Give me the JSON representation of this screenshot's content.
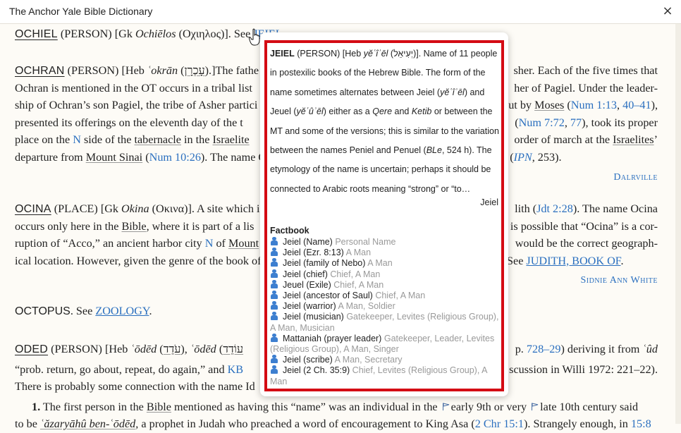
{
  "window": {
    "title": "The Anchor Yale Bible Dictionary",
    "close_icon": "×"
  },
  "ochiel": {
    "hw": "OCHIEL",
    "type": "(PERSON)",
    "gk_pre": "[Gk ",
    "gk_trans": "Ochiēlos",
    "gk_open": " (",
    "gk": "Οχιηλος",
    "gk_close": ")]. See ",
    "see": "JEIEL",
    "end": "."
  },
  "ochran": {
    "hw": "OCHRAN",
    "type": "(PERSON)",
    "heb_pre": "[Heb ",
    "heb_trans": "ʿokrān",
    "heb_open": " (",
    "heb": "עָכְרָן",
    "heb_close": ").]The fathe",
    "right1": "sher. Each of the five times that",
    "line2a": "Ochran is mentioned in the OT occurs in a tribal list",
    "line2b": "her of Pagiel. Under the leader-",
    "line3a": "ship of Ochran’s son Pagiel, the tribe of Asher partici",
    "line3b": "out by ",
    "moses": "Moses",
    "line3c": " (",
    "ref1": "Num 1:13",
    "comma": ", ",
    "ref2": "40–41",
    "line3d": "),",
    "line4a": "presented its offerings on the eleventh day of the t",
    "line4b": " (",
    "ref3": "Num 7:72",
    "ref4": "77",
    "line4c": "), took its proper",
    "line5a": "place on the ",
    "n": "N",
    "line5b": " side of the ",
    "tabernacle": "tabernacle",
    "line5c": " in the ",
    "israelite": "Israelite",
    "line5d": "order of march at the ",
    "israelites": "Israelites",
    "line5e": "’",
    "line6a": "departure from ",
    "sinai": "Mount Sinai",
    "line6b": " (",
    "ref5": "Num 10:26",
    "line6c": "). The name O",
    "line6d": "” (",
    "ipn": "IPN",
    "line6e": ", 253).",
    "author": "Dalrville"
  },
  "ocina": {
    "hw": "OCINA",
    "type": "(PLACE)",
    "gk_pre": "[Gk ",
    "gk_trans": "Okina",
    "gk_open": " (",
    "gk": "Οκινα",
    "gk_close": ")]. A site which is",
    "right1a": "lith (",
    "ref": "Jdt 2:28",
    "right1b": "). The name Ocina",
    "line2a": "occurs only here in the ",
    "bible": "Bible",
    "line2b": ", where it is part of a lis",
    "line2c": "is possible that “Ocina” is a cor-",
    "line3a": "ruption of “Acco,” an ancient harbor city ",
    "n": "N",
    "line3b": " of ",
    "mount": "Mount",
    "line3c": "would be the correct geograph-",
    "line4a": "ical location. However, given the genre of the book of",
    "line4b": "See ",
    "judith": "JUDITH, BOOK OF",
    "line4c": ".",
    "author": "Sidnie Ann White"
  },
  "octopus": {
    "hw": "OCTOPUS",
    "see": ". See ",
    "link": "ZOOLOGY",
    "end": "."
  },
  "oded": {
    "hw": "ODED",
    "type": "(PERSON)",
    "heb_pre": "[Heb ",
    "heb_trans": "ʿōdēd",
    "heb_open": " (",
    "heb": "עֹדֵד",
    "heb_mid": "), ",
    "heb_trans2": "ʿōdēd",
    "heb_open2": " (",
    "heb2": "עוֹדֵד",
    "right1a": "p. ",
    "ref1": "728–29",
    "right1b": ") deriving it from ",
    "root": "ʿûd",
    "line2a": "“prob. return, go about, repeat, do again,” and ",
    "kb": "KB",
    "line2b": "scussion in Willi 1972: 221–22).",
    "line3a": "There is probably some connection with the name Id",
    "line4num": "1.",
    "line4a": " The first person in the ",
    "bible": "Bible",
    "line4b": " mentioned as having this “name” was an individual in the ",
    "line4c": "early 9th or very ",
    "line4d": "late 10th century said",
    "line5a": "to be ",
    "line5it": "ʿăzaryāhû ben-ʿōdēd",
    "line5b": ", a prophet in Judah who preached a word of encouragement to King Asa (",
    "ref2": "2 Chr 15:1",
    "line5c": "). Strangely enough, in ",
    "ref3": "15:8"
  },
  "popup": {
    "hw": "JEIEL",
    "text_a": " (PERSON) [Heb ",
    "trans": "yĕʿîʾēl",
    "open": " (",
    "heb": "יְעִיאֵל",
    "text_b": ")]. Name of 11 people in postexilic books of the Hebrew Bible. The form of the name sometimes alternates between Jeiel (",
    "trans2": "yĕʿîʾēl",
    "text_c": ") and Jeuel (",
    "trans3": "yĕʿûʾēl",
    "text_d": ") either as a ",
    "qere": "Qere",
    "text_e": " and ",
    "ketib": "Ketib",
    "text_f": " or between the MT and some of the versions; this is similar to the variation between the names Peniel and Penuel (",
    "ble": "BLe",
    "text_g": ", 524 h). The etymology of the name is uncertain; perhaps it should be connected to Arabic roots meaning “strong” or “to…",
    "signature": "Jeiel",
    "factbook_title": "Factbook",
    "facts": [
      {
        "name": "Jeiel (Name)",
        "desc": "Personal Name"
      },
      {
        "name": "Jeiel (Ezr. 8:13)",
        "desc": "A Man"
      },
      {
        "name": "Jeiel (family of Nebo)",
        "desc": "A Man"
      },
      {
        "name": "Jeiel (chief)",
        "desc": "Chief, A Man"
      },
      {
        "name": "Jeuel (Exile)",
        "desc": "Chief, A Man"
      },
      {
        "name": "Jeiel (ancestor of Saul)",
        "desc": "Chief, A Man"
      },
      {
        "name": "Jeiel (warrior)",
        "desc": "A Man, Soldier"
      },
      {
        "name": "Jeiel (musician)",
        "desc": "Gatekeeper, Levites (Religious Group), A Man, Musician"
      },
      {
        "name": "Mattaniah (prayer leader)",
        "desc": "Gatekeeper, Leader, Levites (Religious Group), A Man, Singer"
      },
      {
        "name": "Jeiel (scribe)",
        "desc": "A Man, Secretary"
      },
      {
        "name": "Jeiel (2 Ch. 35:9)",
        "desc": "Chief, Levites (Religious Group), A Man"
      }
    ]
  }
}
